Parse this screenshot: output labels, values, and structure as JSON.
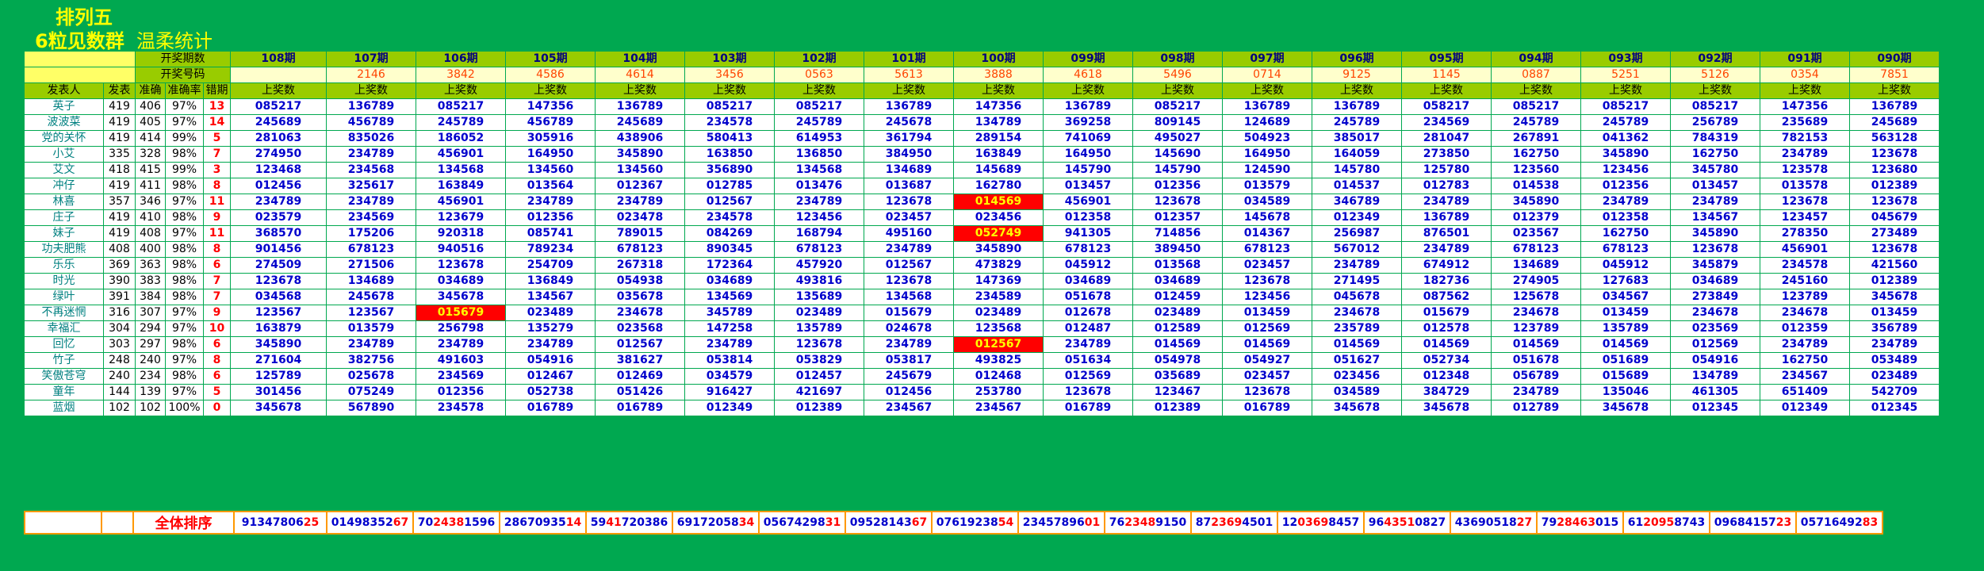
{
  "titles": {
    "line1": "排列五",
    "line2": "6粒见数群",
    "line3": "温柔统计"
  },
  "header": {
    "draw_period_label": "开奖期数",
    "draw_number_label": "开奖号码",
    "poster_label": "发表人",
    "count_label": "发表",
    "correct_label": "准确",
    "rate_label": "准确率",
    "miss_label": "错期",
    "per_col_label": "上奖数"
  },
  "periods": [
    "108期",
    "107期",
    "106期",
    "105期",
    "104期",
    "103期",
    "102期",
    "101期",
    "100期",
    "099期",
    "098期",
    "097期",
    "096期",
    "095期",
    "094期",
    "093期",
    "092期",
    "091期",
    "090期"
  ],
  "draw_numbers": [
    "",
    "2146",
    "3842",
    "4586",
    "4614",
    "3456",
    "0563",
    "5613",
    "3888",
    "4618",
    "5496",
    "0714",
    "9125",
    "1145",
    "0887",
    "5251",
    "5126",
    "0354",
    "7851"
  ],
  "rows": [
    {
      "name": "英子",
      "count": "419",
      "correct": "406",
      "rate": "97%",
      "streak": "13",
      "values": [
        "085217",
        "136789",
        "085217",
        "147356",
        "136789",
        "085217",
        "085217",
        "136789",
        "147356",
        "136789",
        "085217",
        "136789",
        "136789",
        "058217",
        "085217",
        "085217",
        "085217",
        "147356",
        "136789"
      ],
      "hits": []
    },
    {
      "name": "波波菜",
      "count": "419",
      "correct": "405",
      "rate": "97%",
      "streak": "14",
      "values": [
        "245689",
        "456789",
        "245789",
        "456789",
        "245689",
        "234578",
        "245789",
        "245678",
        "134789",
        "369258",
        "809145",
        "124689",
        "245789",
        "234569",
        "245789",
        "245789",
        "256789",
        "235689",
        "245689"
      ],
      "hits": []
    },
    {
      "name": "党的关怀",
      "count": "419",
      "correct": "414",
      "rate": "99%",
      "streak": "5",
      "values": [
        "281063",
        "835026",
        "186052",
        "305916",
        "438906",
        "580413",
        "614953",
        "361794",
        "289154",
        "741069",
        "495027",
        "504923",
        "385017",
        "281047",
        "267891",
        "041362",
        "784319",
        "782153",
        "563128"
      ],
      "hits": []
    },
    {
      "name": "小艾",
      "count": "335",
      "correct": "328",
      "rate": "98%",
      "streak": "7",
      "values": [
        "274950",
        "234789",
        "456901",
        "164950",
        "345890",
        "163850",
        "136850",
        "384950",
        "163849",
        "164950",
        "145690",
        "164950",
        "164059",
        "273850",
        "162750",
        "345890",
        "162750",
        "234789",
        "123678"
      ],
      "hits": []
    },
    {
      "name": "艾文",
      "count": "418",
      "correct": "415",
      "rate": "99%",
      "streak": "3",
      "values": [
        "123468",
        "234568",
        "134568",
        "134560",
        "134560",
        "356890",
        "134568",
        "134689",
        "145689",
        "145790",
        "145790",
        "124590",
        "145780",
        "125780",
        "123560",
        "123456",
        "345780",
        "123578",
        "123680"
      ],
      "hits": []
    },
    {
      "name": "冲仔",
      "count": "419",
      "correct": "411",
      "rate": "98%",
      "streak": "8",
      "values": [
        "012456",
        "325617",
        "163849",
        "013564",
        "012367",
        "012785",
        "013476",
        "013687",
        "162780",
        "013457",
        "012356",
        "013579",
        "014537",
        "012783",
        "014538",
        "012356",
        "013457",
        "013578",
        "012389"
      ],
      "hits": []
    },
    {
      "name": "林喜",
      "count": "357",
      "correct": "346",
      "rate": "97%",
      "streak": "11",
      "values": [
        "234789",
        "234789",
        "456901",
        "234789",
        "234789",
        "012567",
        "234789",
        "123678",
        "014569",
        "456901",
        "123678",
        "034589",
        "346789",
        "234789",
        "345890",
        "234789",
        "234789",
        "123678",
        "123678"
      ],
      "hits": [
        8
      ]
    },
    {
      "name": "庄子",
      "count": "419",
      "correct": "410",
      "rate": "98%",
      "streak": "9",
      "values": [
        "023579",
        "234569",
        "123679",
        "012356",
        "023478",
        "234578",
        "123456",
        "023457",
        "023456",
        "012358",
        "012357",
        "145678",
        "012349",
        "136789",
        "012379",
        "012358",
        "134567",
        "123457",
        "045679"
      ],
      "hits": []
    },
    {
      "name": "妹子",
      "count": "419",
      "correct": "408",
      "rate": "97%",
      "streak": "11",
      "values": [
        "368570",
        "175206",
        "920318",
        "085741",
        "789015",
        "084269",
        "168794",
        "495160",
        "052749",
        "941305",
        "714856",
        "014367",
        "256987",
        "876501",
        "023567",
        "162750",
        "345890",
        "278350",
        "273489"
      ],
      "hits": [
        8
      ]
    },
    {
      "name": "功夫肥熊",
      "count": "408",
      "correct": "400",
      "rate": "98%",
      "streak": "8",
      "values": [
        "901456",
        "678123",
        "940516",
        "789234",
        "678123",
        "890345",
        "678123",
        "234789",
        "345890",
        "678123",
        "389450",
        "678123",
        "567012",
        "234789",
        "678123",
        "678123",
        "123678",
        "456901",
        "123678"
      ],
      "hits": []
    },
    {
      "name": "乐乐",
      "count": "369",
      "correct": "363",
      "rate": "98%",
      "streak": "6",
      "values": [
        "274509",
        "271506",
        "123678",
        "254709",
        "267318",
        "172364",
        "457920",
        "012567",
        "473829",
        "045912",
        "013568",
        "023457",
        "234789",
        "674912",
        "134689",
        "045912",
        "345879",
        "234578",
        "421560"
      ],
      "hits": []
    },
    {
      "name": "时光",
      "count": "390",
      "correct": "383",
      "rate": "98%",
      "streak": "7",
      "values": [
        "123678",
        "134689",
        "034689",
        "136849",
        "054938",
        "034689",
        "493816",
        "123678",
        "147369",
        "034689",
        "034689",
        "123678",
        "271495",
        "182736",
        "274905",
        "127683",
        "034689",
        "245160",
        "012389"
      ],
      "hits": []
    },
    {
      "name": "绿叶",
      "count": "391",
      "correct": "384",
      "rate": "98%",
      "streak": "7",
      "values": [
        "034568",
        "245678",
        "345678",
        "134567",
        "035678",
        "134569",
        "135689",
        "134568",
        "234589",
        "051678",
        "012459",
        "123456",
        "045678",
        "087562",
        "125678",
        "034567",
        "273849",
        "123789",
        "345678"
      ],
      "hits": []
    },
    {
      "name": "不再迷惘",
      "count": "316",
      "correct": "307",
      "rate": "97%",
      "streak": "9",
      "values": [
        "123567",
        "123567",
        "015679",
        "023489",
        "234678",
        "345789",
        "023489",
        "015679",
        "023489",
        "012678",
        "023489",
        "013459",
        "234678",
        "015679",
        "234678",
        "013459",
        "234678",
        "234678",
        "013459"
      ],
      "hits": [
        2
      ]
    },
    {
      "name": "幸福汇",
      "count": "304",
      "correct": "294",
      "rate": "97%",
      "streak": "10",
      "values": [
        "163879",
        "013579",
        "256798",
        "135279",
        "023568",
        "147258",
        "135789",
        "024678",
        "123568",
        "012487",
        "012589",
        "012569",
        "235789",
        "012578",
        "123789",
        "135789",
        "023569",
        "012359",
        "356789"
      ],
      "hits": []
    },
    {
      "name": "回忆",
      "count": "303",
      "correct": "297",
      "rate": "98%",
      "streak": "6",
      "values": [
        "345890",
        "234789",
        "234789",
        "234789",
        "012567",
        "234789",
        "123678",
        "234789",
        "012567",
        "234789",
        "014569",
        "014569",
        "014569",
        "014569",
        "014569",
        "014569",
        "012569",
        "234789",
        "234789"
      ],
      "hits": [
        8
      ]
    },
    {
      "name": "竹子",
      "count": "248",
      "correct": "240",
      "rate": "97%",
      "streak": "8",
      "values": [
        "271604",
        "382756",
        "491603",
        "054916",
        "381627",
        "053814",
        "053829",
        "053817",
        "493825",
        "051634",
        "054978",
        "054927",
        "051627",
        "052734",
        "051678",
        "051689",
        "054916",
        "162750",
        "053489"
      ],
      "hits": []
    },
    {
      "name": "笑傲苍穹",
      "count": "240",
      "correct": "234",
      "rate": "98%",
      "streak": "6",
      "values": [
        "125789",
        "025678",
        "234569",
        "012467",
        "012469",
        "034579",
        "012457",
        "245679",
        "012468",
        "012569",
        "035689",
        "023457",
        "023456",
        "012348",
        "056789",
        "015689",
        "134789",
        "234567",
        "023489"
      ],
      "hits": []
    },
    {
      "name": "童年",
      "count": "144",
      "correct": "139",
      "rate": "97%",
      "streak": "5",
      "values": [
        "301456",
        "075249",
        "012356",
        "052738",
        "051426",
        "916427",
        "421697",
        "012456",
        "253780",
        "123678",
        "123467",
        "123678",
        "034589",
        "384729",
        "234789",
        "135046",
        "461305",
        "651409",
        "542709"
      ],
      "hits": []
    },
    {
      "name": "蓝烟",
      "count": "102",
      "correct": "102",
      "rate": "100%",
      "streak": "0",
      "values": [
        "345678",
        "567890",
        "234578",
        "016789",
        "016789",
        "012349",
        "012389",
        "234567",
        "234567",
        "016789",
        "012389",
        "016789",
        "345678",
        "345678",
        "012789",
        "345678",
        "012345",
        "012349",
        "012345"
      ],
      "hits": []
    }
  ],
  "summary": {
    "label": "全体排序",
    "values": [
      {
        "plain": "91347806",
        "red": "25"
      },
      {
        "plain": "01498352",
        "red": "67"
      },
      {
        "plain": "70",
        "red": "2438",
        "tail": "1596"
      },
      {
        "plain": "28670935",
        "red": "14"
      },
      {
        "plain": "59",
        "red": "41",
        "tail": "720386"
      },
      {
        "plain": "69172058",
        "red": "34"
      },
      {
        "plain": "05674298",
        "red": "31"
      },
      {
        "plain": "09528143",
        "red": "67"
      },
      {
        "plain": "07619238",
        "red": "54"
      },
      {
        "plain": "23457896",
        "red": "01"
      },
      {
        "plain": "76",
        "red": "2348",
        "tail": "9150"
      },
      {
        "plain": "87",
        "red": "2369",
        "tail": "4501"
      },
      {
        "plain": "12",
        "red": "0369",
        "tail": "8457"
      },
      {
        "plain": "96",
        "red": "4351",
        "tail": "0827"
      },
      {
        "plain": "43690518",
        "red": "27"
      },
      {
        "plain": "79",
        "red": "28463",
        "tail": "015"
      },
      {
        "plain": "61",
        "red": "2095",
        "tail": "8743"
      },
      {
        "plain": "09684157",
        "red": "23"
      },
      {
        "plain": "05716492",
        "red": "83"
      }
    ]
  },
  "colors": {
    "background": "#00a850",
    "header_green": "#99cc00",
    "hit_bg": "#ff0000",
    "hit_fg": "#ffff00",
    "value_blue": "#0000cc"
  }
}
